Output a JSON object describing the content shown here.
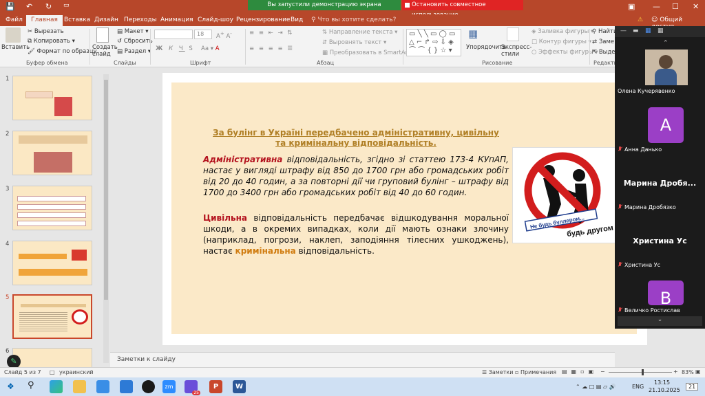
{
  "app": {
    "banner_share": "Вы запустили демонстрацию экрана",
    "banner_stop": "Остановить совместное использование",
    "share_button": "Общий доступ"
  },
  "tabs": [
    "Файл",
    "Главная",
    "Вставка",
    "Дизайн",
    "Переходы",
    "Анимация",
    "Слайд-шоу",
    "Рецензирование",
    "Вид"
  ],
  "tell_me": "Что вы хотите сделать?",
  "ribbon": {
    "paste": "Вставить",
    "cut": "Вырезать",
    "copy": "Копировать",
    "format_painter": "Формат по образцу",
    "new_slide": "Создать слайд",
    "layout": "Макет",
    "reset": "Сбросить",
    "section": "Раздел",
    "font_size": "18",
    "text_direction": "Направление текста",
    "align_text": "Выровнять текст",
    "convert_smartart": "Преобразовать в SmartArt",
    "arrange": "Упорядочить",
    "quick_styles": "Экспресс-стили",
    "shape_fill": "Заливка фигуры",
    "shape_outline": "Контур фигуры",
    "shape_effects": "Эффекты фигуры",
    "find": "Найти",
    "replace": "Заме",
    "select": "Выде",
    "groups": {
      "clipboard": "Буфер обмена",
      "slides": "Слайды",
      "font": "Шрифт",
      "paragraph": "Абзац",
      "drawing": "Рисование",
      "editing": "Редакти"
    }
  },
  "thumbnails": [
    "1",
    "2",
    "3",
    "4",
    "5",
    "6"
  ],
  "slide": {
    "heading": "За булінг в Україні передбачено адміністративну, цивільну та кримінальну відповідальність.",
    "p1_bold": "Адміністративна",
    "p1_rest": " відповідальність, згідно зі статтею 173-4 КУпАП, настає у вигляді штрафу від 850 до 1700 грн або громадських робіт від 20 до 40 годин, а за повторні дії чи груповий булінг – штрафу від 1700 до 3400 грн або громадських робіт від 40 до 60 годин.",
    "p2_bold": "Цивільна",
    "p2_rest": " відповідальність передбачає відшкодування моральної шкоди, а в окремих випадках, коли дії мають ознаки злочину (наприклад, погрози, наклеп, заподіяння тілесних ушкоджень), настає ",
    "p2_orange": "кримінальна",
    "p2_end": " відповідальність.",
    "picture_caption_1": "Не будь буллером...",
    "picture_caption_2": "будь другом"
  },
  "notes_placeholder": "Заметки к слайду",
  "status": {
    "slide_of": "Слайд 5 из 7",
    "language": "украинский",
    "notes": "Заметки",
    "comments": "Примечания",
    "zoom": "83%"
  },
  "meeting": {
    "self_name": "Олена Кучерявенко",
    "participants": [
      {
        "initial": "A",
        "name": "Анна Данько"
      },
      {
        "big": "Марина Дробя...",
        "name": "Марина Дробязко"
      },
      {
        "big": "Христина Ус",
        "name": "Христина Ус"
      },
      {
        "initial": "B",
        "name": "Величко Ростислав"
      }
    ]
  },
  "taskbar": {
    "lang": "ENG",
    "time": "13:15",
    "date": "21.10.2025",
    "notif": "21",
    "badge": "25"
  },
  "colors": {
    "office_red": "#b7472a",
    "slide_bg": "#fbe9c8",
    "heading": "#b07f25",
    "accent_red": "#b4121e",
    "accent_orange": "#d07c10"
  }
}
